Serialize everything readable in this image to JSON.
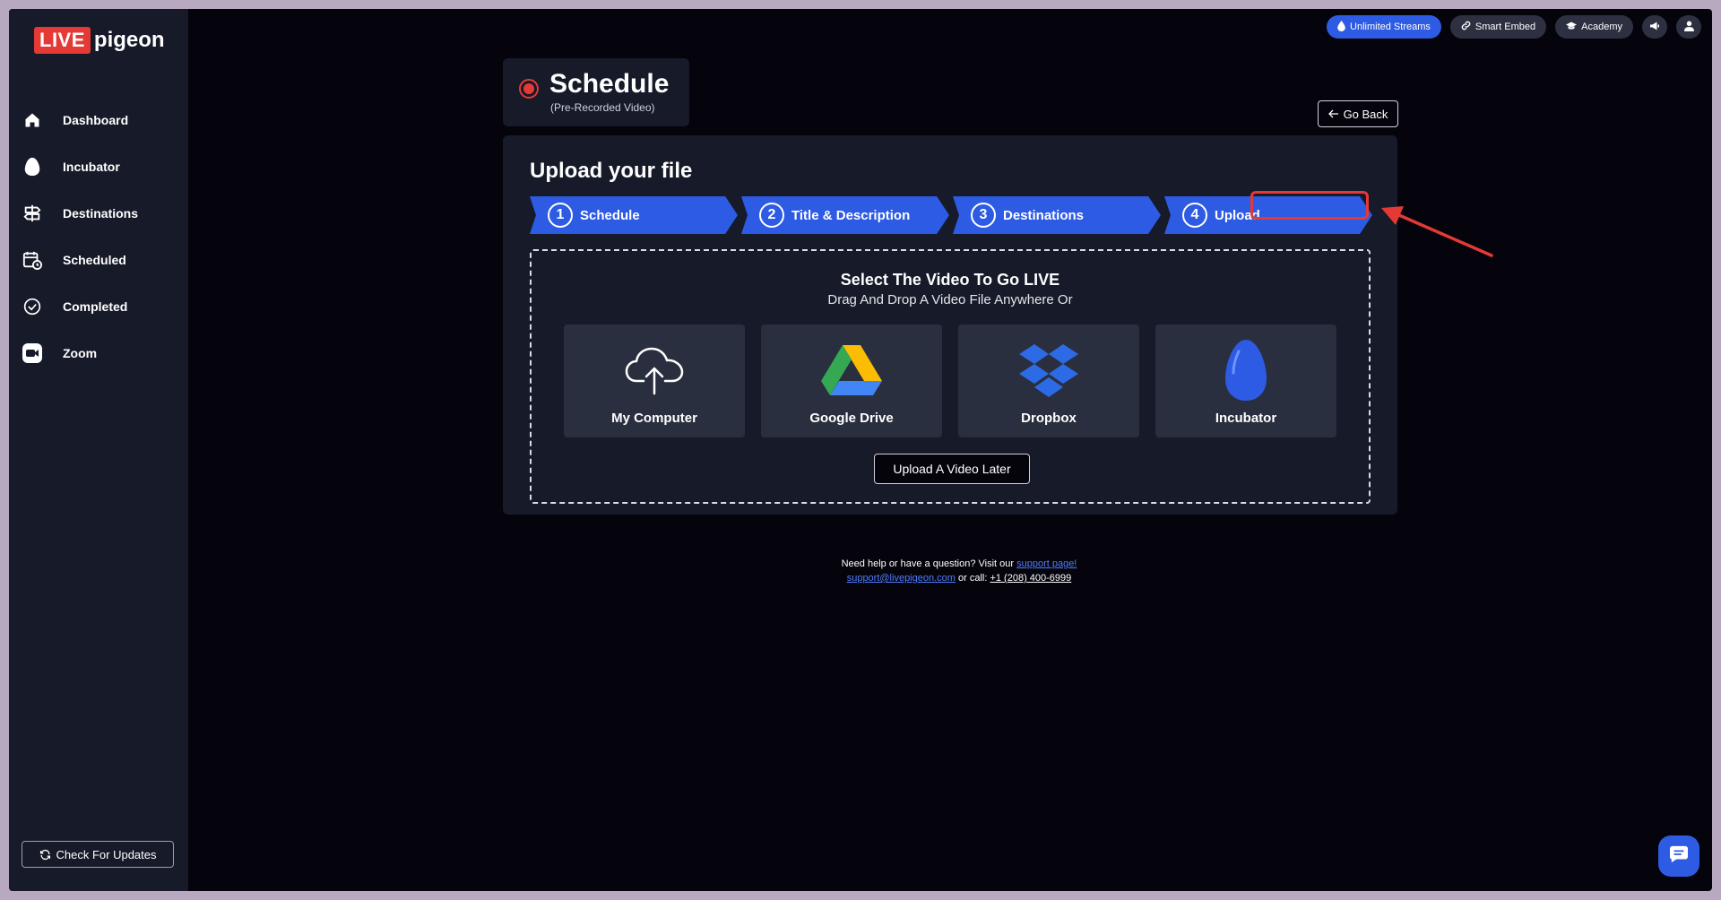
{
  "sidebar": {
    "logo_live": "LIVE",
    "logo_pigeon": "pigeon",
    "items": [
      {
        "label": "Dashboard",
        "icon": "home-icon"
      },
      {
        "label": "Incubator",
        "icon": "egg-icon"
      },
      {
        "label": "Destinations",
        "icon": "signpost-icon"
      },
      {
        "label": "Scheduled",
        "icon": "calendar-clock-icon"
      },
      {
        "label": "Completed",
        "icon": "check-circle-icon"
      },
      {
        "label": "Zoom",
        "icon": "zoom-icon"
      }
    ],
    "check_updates": "Check For Updates"
  },
  "topbar": {
    "unlimited_streams": "Unlimited Streams",
    "smart_embed": "Smart Embed",
    "academy": "Academy"
  },
  "header": {
    "title": "Schedule",
    "subtitle": "(Pre-Recorded Video)",
    "go_back": "Go Back"
  },
  "main": {
    "title": "Upload your file",
    "steps": [
      {
        "num": "1",
        "label": "Schedule"
      },
      {
        "num": "2",
        "label": "Title & Description"
      },
      {
        "num": "3",
        "label": "Destinations"
      },
      {
        "num": "4",
        "label": "Upload"
      }
    ],
    "dropzone": {
      "title": "Select The Video To Go LIVE",
      "subtitle": "Drag And Drop A Video File Anywhere Or",
      "sources": [
        {
          "label": "My Computer",
          "icon": "cloud-upload-icon"
        },
        {
          "label": "Google Drive",
          "icon": "google-drive-icon"
        },
        {
          "label": "Dropbox",
          "icon": "dropbox-icon"
        },
        {
          "label": "Incubator",
          "icon": "egg-icon"
        }
      ],
      "upload_later": "Upload A Video Later"
    }
  },
  "footer": {
    "line1": "Need help or have a question? Visit our ",
    "support_link": "support page!",
    "email": "support@livepigeon.com",
    "or_call": " or call: ",
    "phone": "+1 (208) 400-6999"
  },
  "colors": {
    "accent": "#2d5be3",
    "brand_red": "#e53935",
    "sidebar_bg": "#161a29",
    "page_bg": "#05040c"
  }
}
